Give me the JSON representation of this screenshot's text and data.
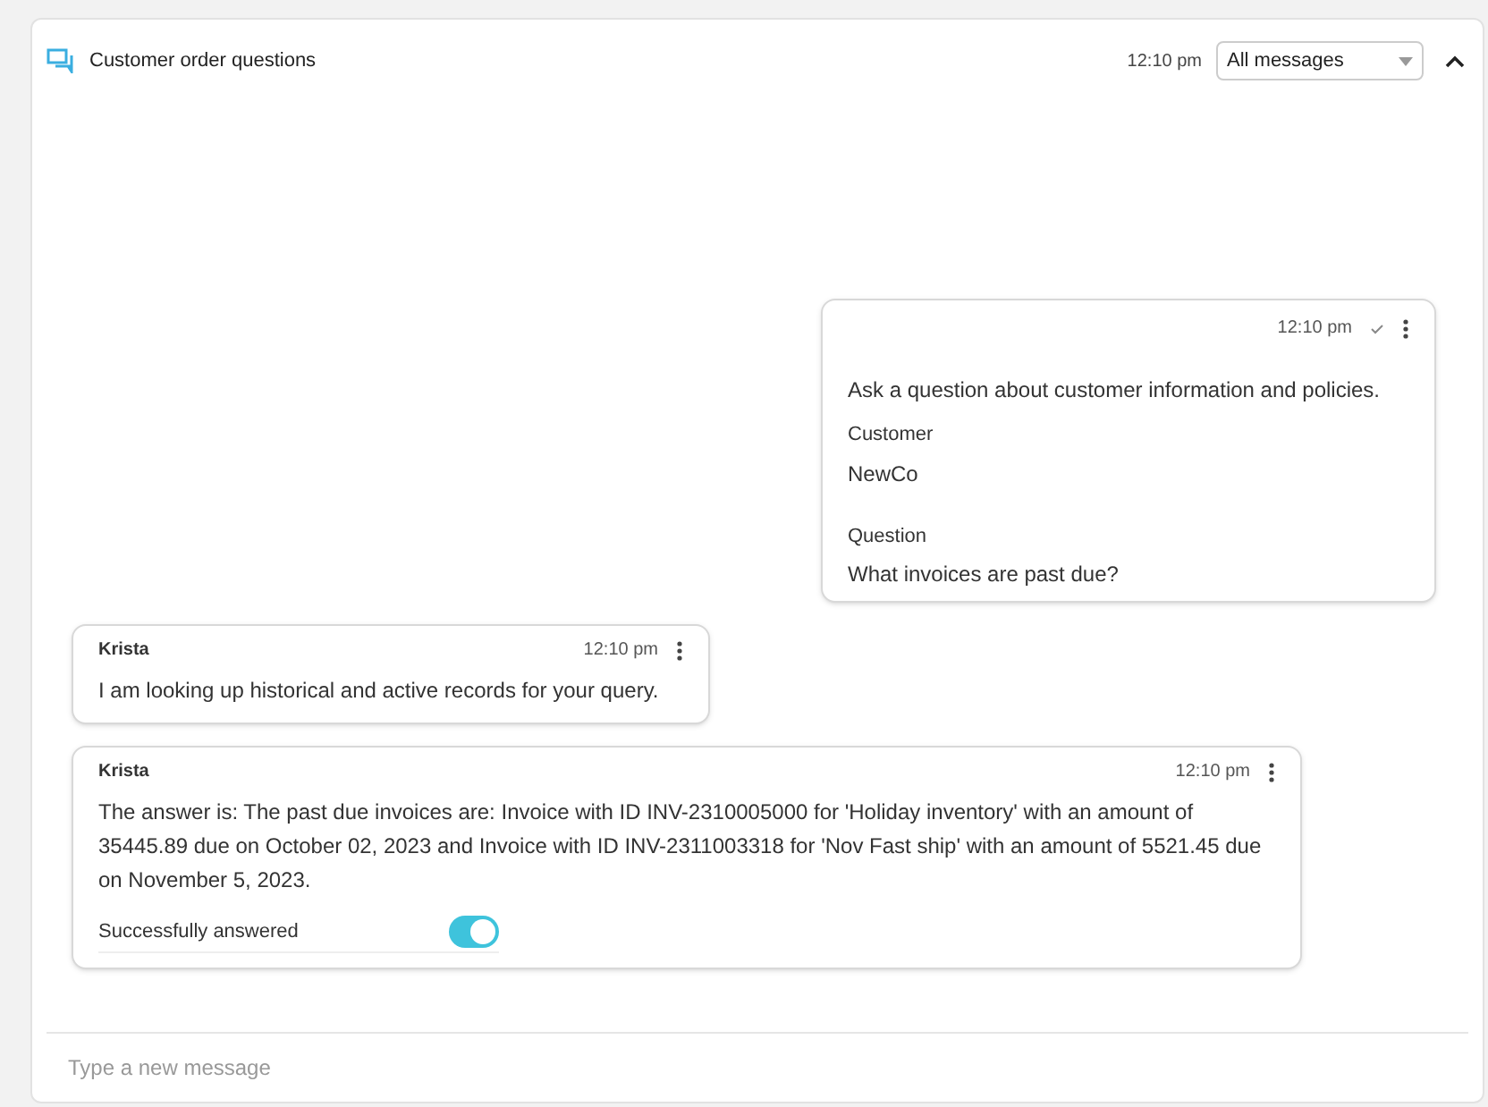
{
  "header": {
    "title": "Customer order questions",
    "time": "12:10 pm",
    "filter": "All messages"
  },
  "messages": [
    {
      "kind": "outgoing",
      "time": "12:10 pm",
      "delivered": true,
      "intro": "Ask a question about customer information and policies.",
      "fields": [
        {
          "label": "Customer",
          "value": "NewCo"
        },
        {
          "label": "Question",
          "value": "What invoices are past due?"
        }
      ]
    },
    {
      "kind": "incoming",
      "sender": "Krista",
      "time": "12:10 pm",
      "text": "I am looking up historical and active records for your query."
    },
    {
      "kind": "incoming",
      "sender": "Krista",
      "time": "12:10 pm",
      "text": "The answer is: The past due invoices are: Invoice with ID INV-2310005000 for 'Holiday inventory' with an amount of 35445.89 due on October 02, 2023 and Invoice with ID INV-2311003318 for 'Nov Fast ship' with an amount of 5521.45 due on November 5, 2023.",
      "toggle": {
        "label": "Successfully answered",
        "on": true
      }
    }
  ],
  "composer": {
    "placeholder": "Type a new message"
  }
}
